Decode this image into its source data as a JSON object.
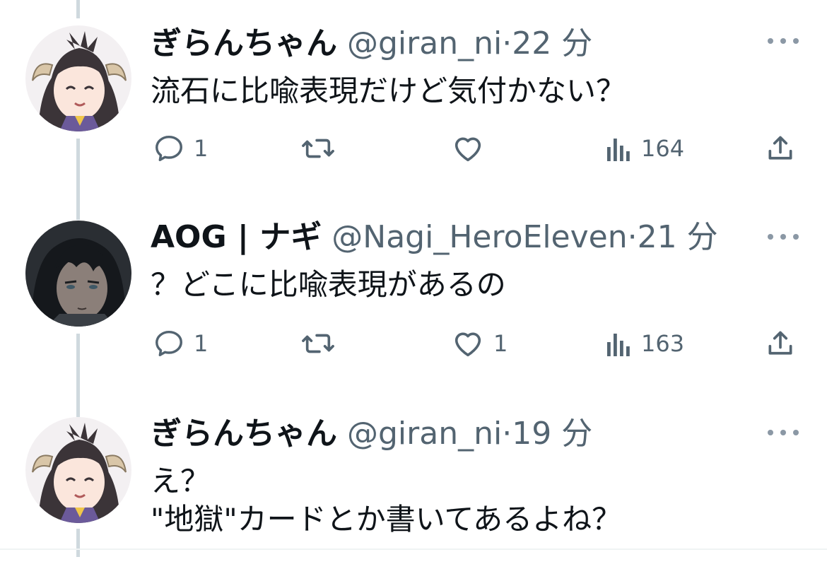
{
  "tweets": [
    {
      "name": "ぎらんちゃん",
      "handle": "@giran_ni",
      "sep": "·",
      "time": "22 分",
      "text": "流石に比喩表現だけど気付かない？",
      "avatar_icon": "anime-horned-girl-avatar",
      "replies": "1",
      "retweets": "",
      "likes": "",
      "views": "164"
    },
    {
      "name": "AOG | ナギ",
      "handle": "@Nagi_HeroEleven",
      "sep": "·",
      "time": "21 分",
      "text": "？どこに比喩表現があるの",
      "avatar_icon": "anime-dark-haired-boy-avatar",
      "replies": "1",
      "retweets": "",
      "likes": "1",
      "views": "163"
    },
    {
      "name": "ぎらんちゃん",
      "handle": "@giran_ni",
      "sep": "·",
      "time": "19 分",
      "text": "え？\n\"地獄\"カードとか書いてあるよね？",
      "avatar_icon": "anime-horned-girl-avatar"
    }
  ],
  "colors": {
    "text": "#0f1419",
    "secondary": "#536471",
    "thread_line": "#cfd9de",
    "divider": "#eff3f4"
  }
}
